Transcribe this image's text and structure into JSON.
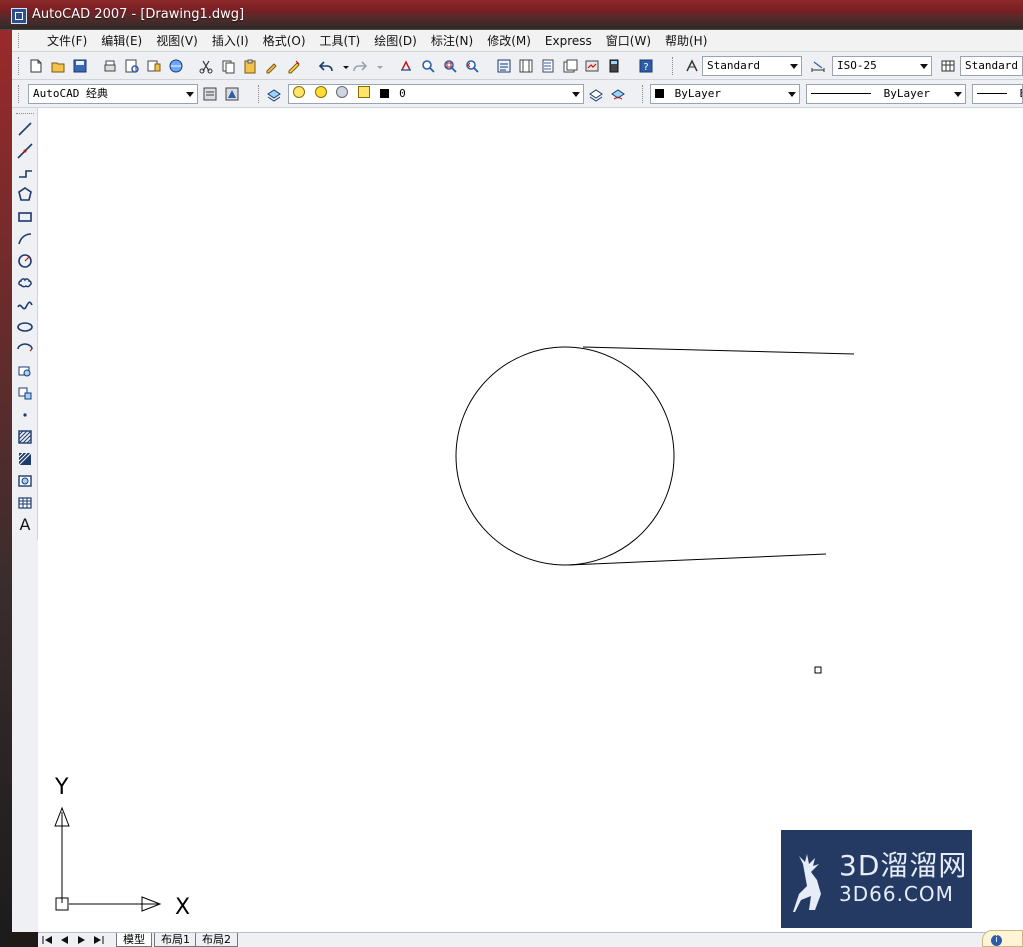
{
  "window": {
    "title": "AutoCAD 2007 - [Drawing1.dwg]"
  },
  "menu": {
    "items": [
      {
        "label": "文件(F)"
      },
      {
        "label": "编辑(E)"
      },
      {
        "label": "视图(V)"
      },
      {
        "label": "插入(I)"
      },
      {
        "label": "格式(O)"
      },
      {
        "label": "工具(T)"
      },
      {
        "label": "绘图(D)"
      },
      {
        "label": "标注(N)"
      },
      {
        "label": "修改(M)"
      },
      {
        "label": "Express"
      },
      {
        "label": "窗口(W)"
      },
      {
        "label": "帮助(H)"
      }
    ]
  },
  "toolbar1": {
    "text_style": "Standard",
    "dim_style": "ISO-25",
    "table_style": "Standard"
  },
  "toolbar2": {
    "workspace": "AutoCAD 经典",
    "layer": "0",
    "color": "ByLayer",
    "linetype": "ByLayer",
    "lineweight_partial": "B"
  },
  "drawtools": [
    {
      "icon": "line-icon"
    },
    {
      "icon": "construction-line-icon"
    },
    {
      "icon": "polyline-icon"
    },
    {
      "icon": "polygon-icon"
    },
    {
      "icon": "rectangle-icon"
    },
    {
      "icon": "arc-icon"
    },
    {
      "icon": "circle-icon"
    },
    {
      "icon": "revision-cloud-icon"
    },
    {
      "icon": "spline-icon"
    },
    {
      "icon": "ellipse-icon"
    },
    {
      "icon": "ellipse-arc-icon"
    },
    {
      "icon": "insert-block-icon"
    },
    {
      "icon": "make-block-icon"
    },
    {
      "icon": "point-icon"
    },
    {
      "icon": "hatch-icon"
    },
    {
      "icon": "gradient-icon"
    },
    {
      "icon": "region-icon"
    },
    {
      "icon": "table-icon"
    },
    {
      "icon": "multiline-text-icon",
      "label": "A"
    }
  ],
  "ucs": {
    "x_label": "X",
    "y_label": "Y"
  },
  "layout_tabs": [
    {
      "label": "模型",
      "active": true
    },
    {
      "label": "布局1",
      "active": false
    },
    {
      "label": "布局2",
      "active": false
    }
  ],
  "watermark": {
    "brand_cn": "3D溜溜网",
    "brand_en": "3D66.COM"
  }
}
